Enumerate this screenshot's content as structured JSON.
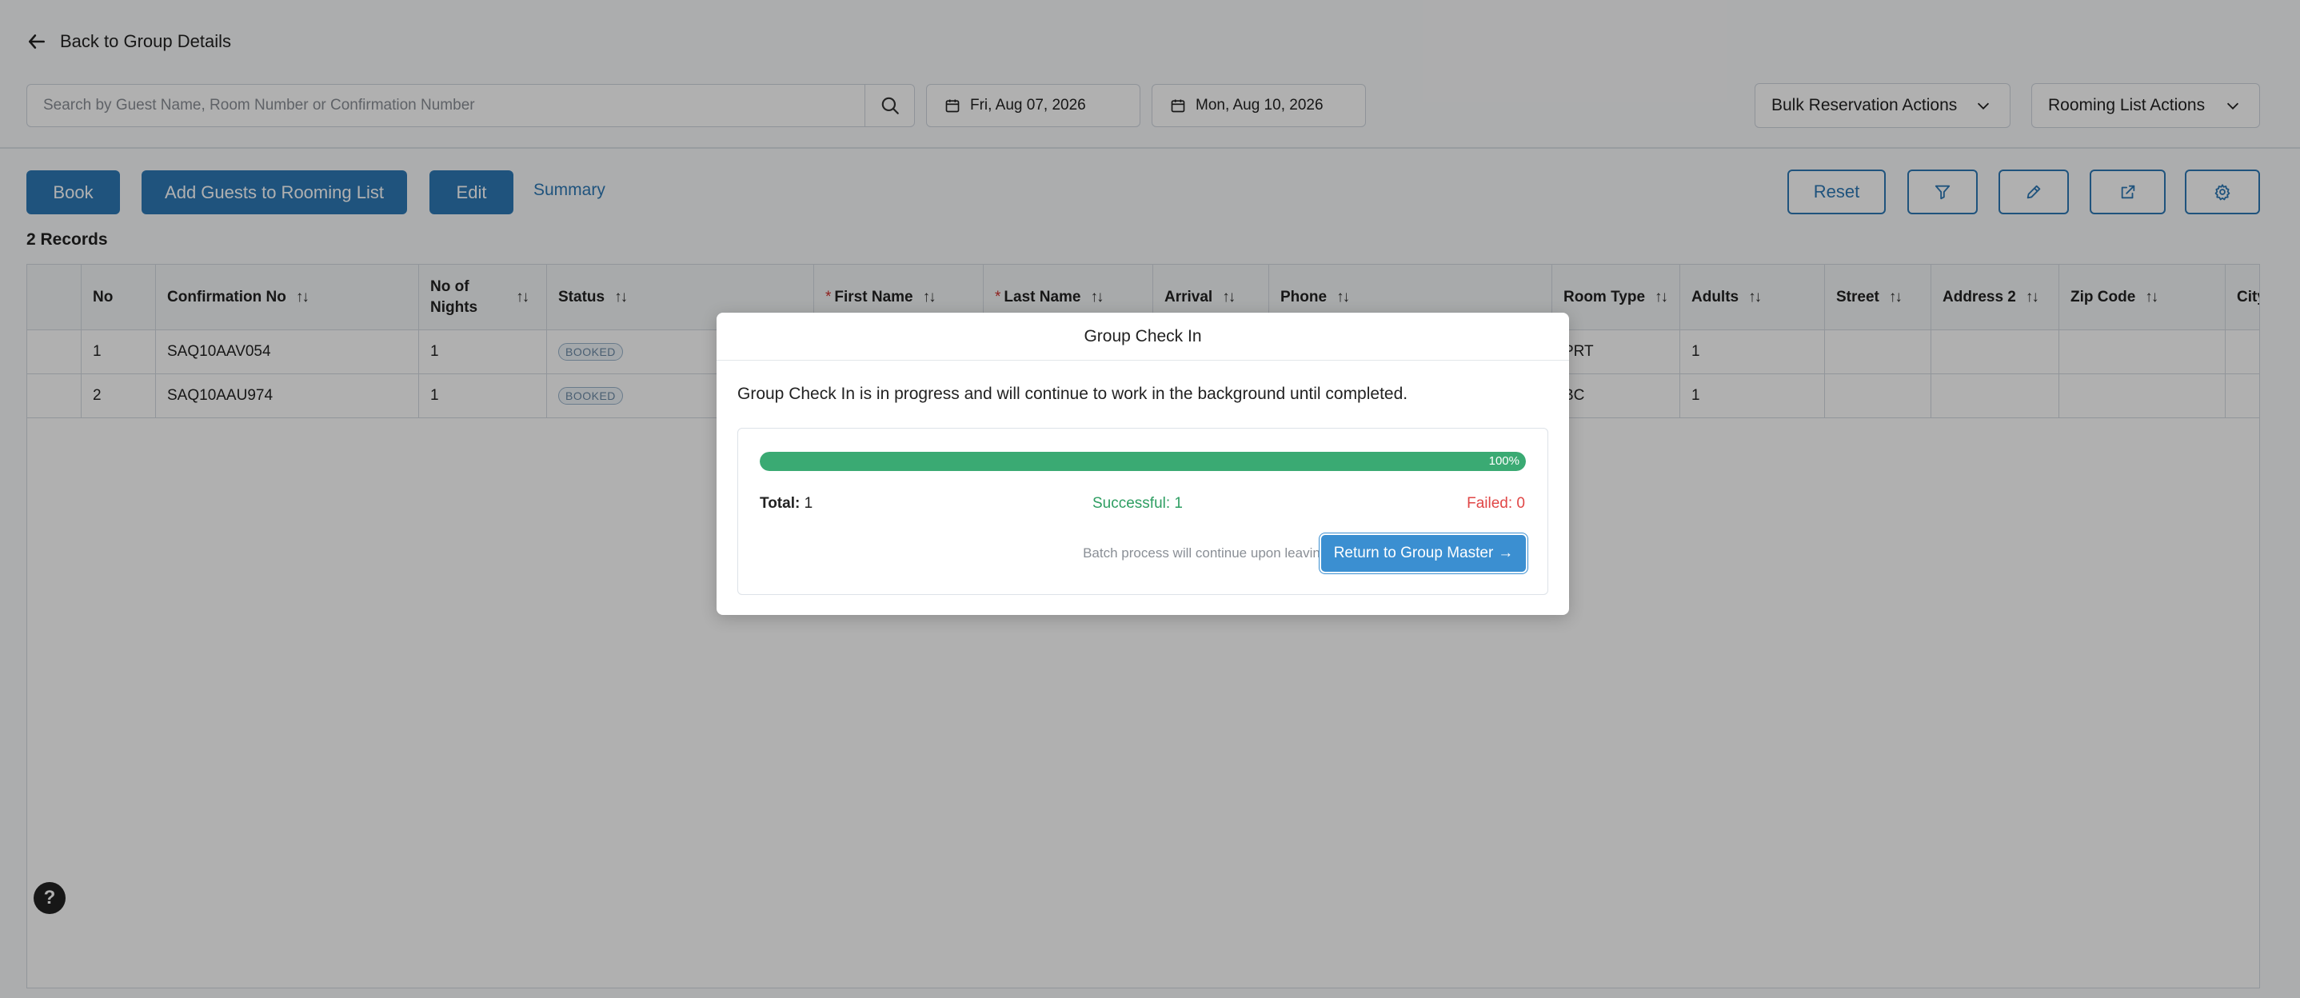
{
  "nav": {
    "back_label": "Back to Group Details"
  },
  "search": {
    "placeholder": "Search by Guest Name, Room Number or Confirmation Number",
    "value": ""
  },
  "dates": {
    "from": "Fri, Aug 07, 2026",
    "to": "Mon, Aug 10, 2026"
  },
  "dropdowns": {
    "bulk": "Bulk Reservation Actions",
    "rooming": "Rooming List Actions"
  },
  "actions": {
    "book": "Book",
    "add_guests": "Add Guests to Rooming List",
    "edit": "Edit",
    "summary": "Summary",
    "reset": "Reset"
  },
  "records_label": "2 Records",
  "table": {
    "headers": {
      "no": "No",
      "confirmation": "Confirmation No",
      "nights_line1": "No of",
      "nights_line2": "Nights",
      "status": "Status",
      "first_name": "First Name",
      "last_name": "Last Name",
      "arrival": "Arrival",
      "phone": "Phone",
      "room_type": "Room Type",
      "adults": "Adults",
      "street": "Street",
      "address2": "Address 2",
      "zip": "Zip Code",
      "city": "City"
    },
    "sort_glyph": "↑↓",
    "required_mark": "*",
    "rows": [
      {
        "no": "1",
        "confirmation": "SAQ10AAV054",
        "nights": "1",
        "status": "BOOKED",
        "room_type": "PRT",
        "adults": "1"
      },
      {
        "no": "2",
        "confirmation": "SAQ10AAU974",
        "nights": "1",
        "status": "BOOKED",
        "room_type": "BC",
        "adults": "1"
      }
    ]
  },
  "help_label": "?",
  "modal": {
    "title": "Group Check In",
    "message": "Group Check In is in progress and will continue to work in the background until completed.",
    "progress_percent": 100,
    "progress_label": "100%",
    "total_label": "Total:",
    "total_value": "1",
    "success_text": "Successful: 1",
    "failed_text": "Failed: 0",
    "note": "Batch process will continue upon leaving.",
    "return_label": "Return to Group Master",
    "return_arrow": "→"
  },
  "colors": {
    "primary": "#2e79b6",
    "success": "#3aaa73",
    "failed": "#e04646",
    "return_button": "#3b8fd1"
  },
  "icons": [
    "arrow-left-icon",
    "search-icon",
    "calendar-icon",
    "chevron-down-icon",
    "filter-icon",
    "pencil-icon",
    "external-link-icon",
    "gear-icon",
    "help-icon"
  ]
}
